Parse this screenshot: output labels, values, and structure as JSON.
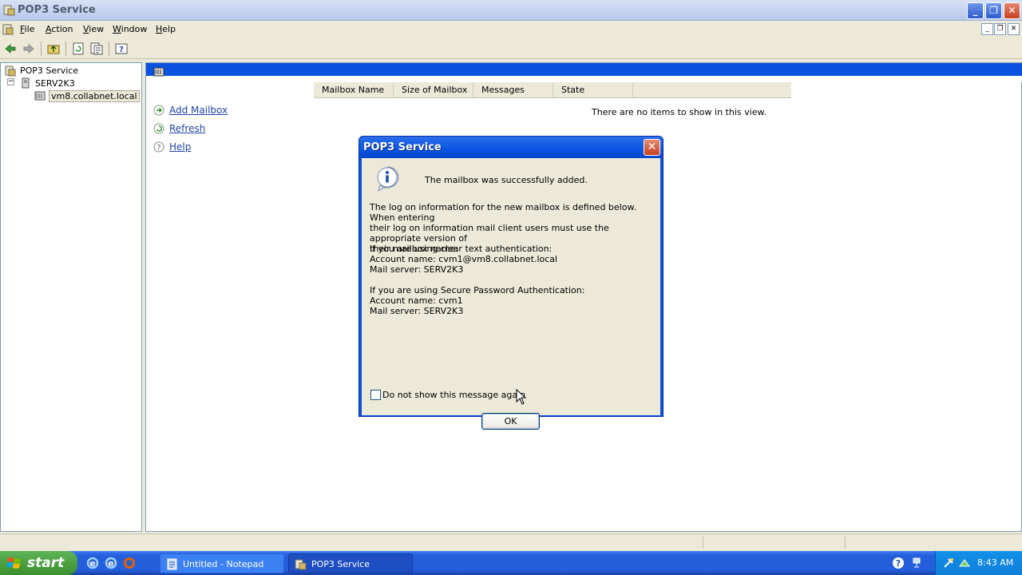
{
  "window": {
    "title": "POP3 Service",
    "controls": {
      "minimize": "_",
      "restore": "❐",
      "close": "✕"
    }
  },
  "menubar": {
    "items": [
      {
        "label": "File",
        "accel": "F"
      },
      {
        "label": "Action",
        "accel": "A"
      },
      {
        "label": "View",
        "accel": "V"
      },
      {
        "label": "Window",
        "accel": "W"
      },
      {
        "label": "Help",
        "accel": "H"
      }
    ]
  },
  "toolbar": {
    "icons": [
      "back-arrow-icon",
      "forward-arrow-icon",
      "up-folder-icon",
      "refresh-icon",
      "export-list-icon",
      "help-icon"
    ]
  },
  "tree": {
    "root": "POP3 Service",
    "server": "SERV2K3",
    "domain": "vm8.collabnet.local"
  },
  "taskpad": {
    "actions": [
      {
        "label": "Add Mailbox",
        "icon": "add-arrow-icon"
      },
      {
        "label": "Refresh",
        "icon": "refresh-icon"
      },
      {
        "label": "Help",
        "icon": "question-icon"
      }
    ]
  },
  "list": {
    "columns": [
      "Mailbox Name",
      "Size of Mailbox",
      "Messages",
      "State"
    ],
    "empty_message": "There are no items to show in this view."
  },
  "dialog": {
    "title": "POP3 Service",
    "close": "✕",
    "headline": "The mailbox was successfully added.",
    "paragraph1": "The log on information for the new mailbox is defined below.  When entering\ntheir log on information mail client users must use the appropriate version of\ntheir mailbox name:",
    "paragraph2": "If you are using clear text authentication:\nAccount name: cvm1@vm8.collabnet.local\nMail server: SERV2K3",
    "paragraph3": "If you are using Secure Password Authentication:\nAccount name: cvm1\nMail server: SERV2K3",
    "checkbox_label": "Do not show this message again",
    "checkbox_checked": false,
    "ok_label": "OK"
  },
  "taskbar": {
    "start_label": "start",
    "quicklaunch": [
      "ie-icon",
      "ie-icon",
      "firefox-icon"
    ],
    "buttons": [
      {
        "label": "Untitled - Notepad",
        "active": false
      },
      {
        "label": "POP3 Service",
        "active": true
      }
    ],
    "clock": "8:43 AM"
  },
  "colors": {
    "xp_blue": "#0b51e0",
    "link": "#2144a7",
    "dialog_face": "#ece9d8",
    "start_green": "#3c8f2e"
  }
}
